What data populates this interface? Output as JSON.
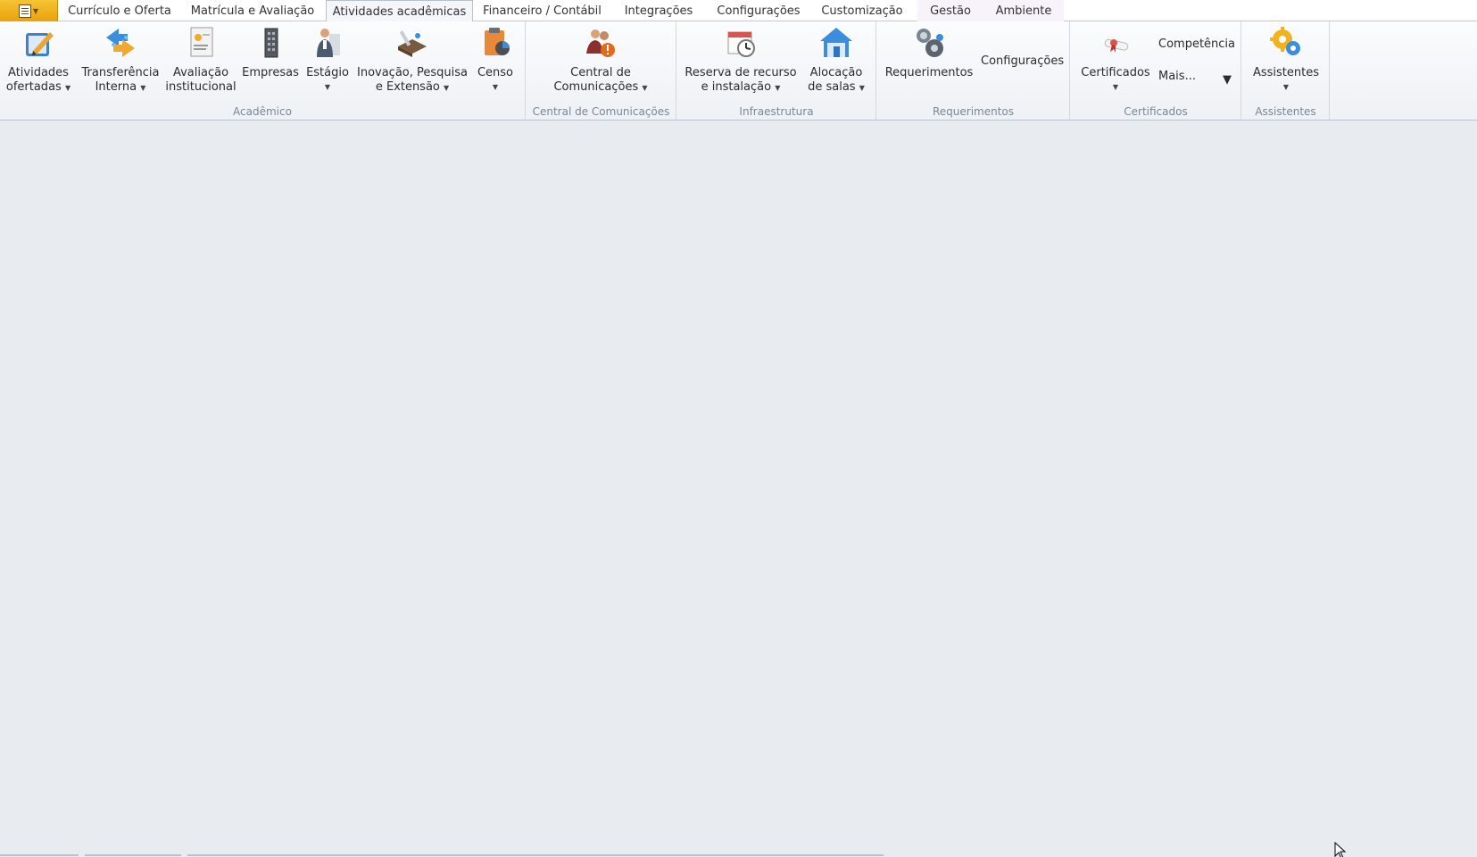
{
  "tabs": [
    {
      "label": "Currículo e Oferta"
    },
    {
      "label": "Matrícula e Avaliação"
    },
    {
      "label": "Atividades acadêmicas",
      "active": true
    },
    {
      "label": "Financeiro / Contábil"
    },
    {
      "label": "Integrações"
    },
    {
      "label": "Configurações"
    },
    {
      "label": "Customização"
    },
    {
      "label": "Gestão"
    },
    {
      "label": "Ambiente"
    }
  ],
  "ribbon": {
    "academico": {
      "label": "Acadêmico",
      "buttons": [
        {
          "line1": "Atividades",
          "line2": "ofertadas",
          "dropdown": true,
          "icon": "edit-pencil-icon"
        },
        {
          "line1": "Transferência",
          "line2": "Interna",
          "dropdown": true,
          "icon": "transfer-icon"
        },
        {
          "line1": "Avaliação",
          "line2": "institucional",
          "dropdown": false,
          "icon": "evaluation-icon"
        },
        {
          "line1": "Empresas",
          "line2": "",
          "dropdown": false,
          "icon": "building-icon"
        },
        {
          "line1": "Estágio",
          "line2": "",
          "dropdown": true,
          "icon": "intern-icon"
        },
        {
          "line1": "Inovação, Pesquisa",
          "line2": "e Extensão",
          "dropdown": true,
          "icon": "research-icon"
        },
        {
          "line1": "Censo",
          "line2": "",
          "dropdown": true,
          "icon": "census-icon"
        }
      ]
    },
    "central": {
      "label": "Central de Comunicações",
      "buttons": [
        {
          "line1": "Central de",
          "line2": "Comunicações",
          "dropdown": true,
          "icon": "communications-icon"
        }
      ]
    },
    "infra": {
      "label": "Infraestrutura",
      "buttons": [
        {
          "line1": "Reserva de recurso",
          "line2": "e instalação",
          "dropdown": true,
          "icon": "calendar-clock-icon"
        },
        {
          "line1": "Alocação",
          "line2": "de salas",
          "dropdown": true,
          "icon": "house-icon"
        }
      ]
    },
    "requerimentos": {
      "label": "Requerimentos",
      "buttons": [
        {
          "line1": "Requerimentos",
          "line2": "",
          "dropdown": false,
          "icon": "requests-icon"
        }
      ],
      "small": "Configurações"
    },
    "certificados": {
      "label": "Certificados",
      "buttons": [
        {
          "line1": "Certificados",
          "line2": "",
          "dropdown": true,
          "icon": "certificate-icon"
        }
      ],
      "small_top": "Competência",
      "small_more": "Mais..."
    },
    "assistentes": {
      "label": "Assistentes",
      "buttons": [
        {
          "line1": "Assistentes",
          "line2": "",
          "dropdown": true,
          "icon": "gears-icon"
        }
      ]
    }
  },
  "colors": {
    "app_button": "#f0b21e",
    "ribbon_bg": "#f4f6f9",
    "workspace_bg": "#e8ebf0"
  }
}
